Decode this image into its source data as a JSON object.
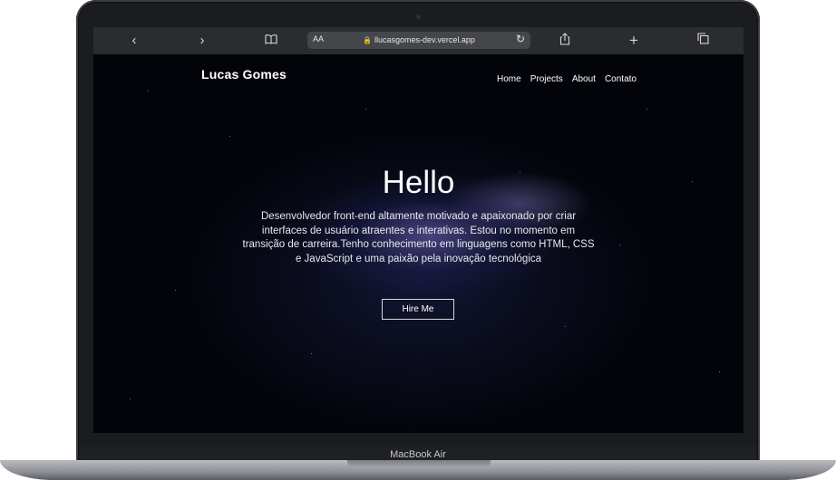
{
  "device": {
    "label": "MacBook Air"
  },
  "browser": {
    "text_size_label": "AA",
    "url": "llucasgomes-dev.vercel.app",
    "icons": [
      "chevron-left-icon",
      "chevron-right-icon",
      "book-icon",
      "lock-icon",
      "reload-icon",
      "share-icon",
      "plus-icon",
      "tabs-icon"
    ]
  },
  "site": {
    "logo": "Lucas Gomes",
    "nav": [
      {
        "label": "Home"
      },
      {
        "label": "Projects"
      },
      {
        "label": "About"
      },
      {
        "label": "Contato"
      }
    ],
    "hero": {
      "title": "Hello",
      "description": "Desenvolvedor front-end altamente motivado e apaixonado por criar interfaces de usuário atraentes e interativas. Estou no momento em transição de carreira.Tenho conhecimento em linguagens como HTML, CSS e JavaScript e uma paixão pela inovação tecnológica",
      "cta_label": "Hire Me"
    }
  }
}
